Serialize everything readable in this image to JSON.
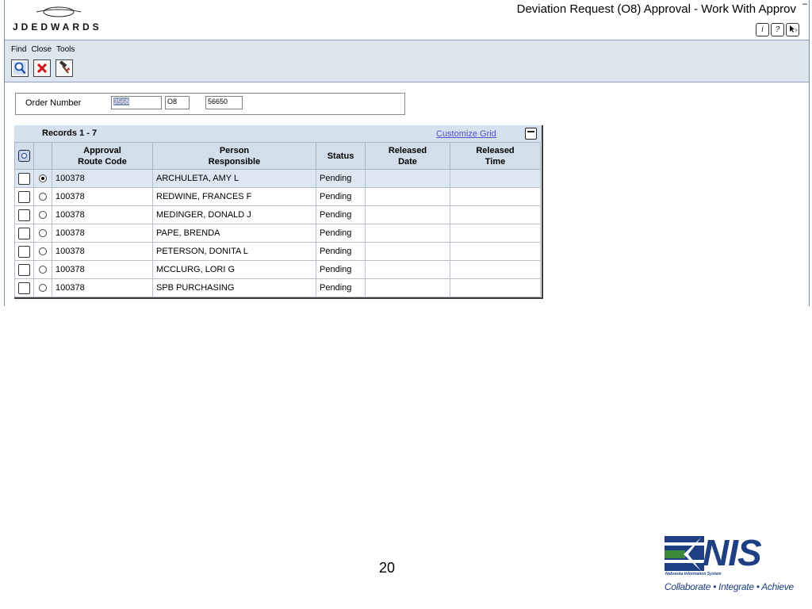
{
  "app": {
    "brand": "JDEDWARDS",
    "title": "Deviation Request (O8) Approval - Work With Approv",
    "help_icons": [
      "i",
      "?",
      "pointer-help"
    ]
  },
  "toolbar": {
    "menus": [
      "Find",
      "Close",
      "Tools"
    ],
    "buttons": [
      {
        "name": "find",
        "icon": "magnifier-icon"
      },
      {
        "name": "close",
        "icon": "red-x-icon"
      },
      {
        "name": "tools",
        "icon": "hammer-icon"
      }
    ]
  },
  "filter": {
    "label": "Order Number",
    "company": "3568",
    "order_type": "O8",
    "order_number": "56650"
  },
  "grid": {
    "records_label": "Records 1 - 7",
    "customize_label": "Customize Grid",
    "columns": [
      {
        "line1": "Approval",
        "line2": "Route Code"
      },
      {
        "line1": "Person",
        "line2": "Responsible"
      },
      {
        "line1": "Status",
        "line2": ""
      },
      {
        "line1": "Released",
        "line2": "Date"
      },
      {
        "line1": "Released",
        "line2": "Time"
      }
    ],
    "rows": [
      {
        "route": "100378",
        "person": "ARCHULETA, AMY L",
        "status": "Pending",
        "date": "",
        "time": "",
        "selected": true
      },
      {
        "route": "100378",
        "person": "REDWINE, FRANCES F",
        "status": "Pending",
        "date": "",
        "time": "",
        "selected": false
      },
      {
        "route": "100378",
        "person": "MEDINGER, DONALD J",
        "status": "Pending",
        "date": "",
        "time": "",
        "selected": false
      },
      {
        "route": "100378",
        "person": "PAPE, BRENDA",
        "status": "Pending",
        "date": "",
        "time": "",
        "selected": false
      },
      {
        "route": "100378",
        "person": "PETERSON, DONITA L",
        "status": "Pending",
        "date": "",
        "time": "",
        "selected": false
      },
      {
        "route": "100378",
        "person": "MCCLURG, LORI G",
        "status": "Pending",
        "date": "",
        "time": "",
        "selected": false
      },
      {
        "route": "100378",
        "person": "SPB PURCHASING",
        "status": "Pending",
        "date": "",
        "time": "",
        "selected": false
      }
    ]
  },
  "slide": {
    "page_number": "20",
    "logo_text": "NIS",
    "logo_subtitle": "Nebraska Information System",
    "tagline": "Collaborate • Integrate • Achieve"
  },
  "colors": {
    "grid_header": "#d2deea",
    "toolbar_bg": "#dde5ee",
    "link": "#5050c8",
    "nis_blue": "#1e3f82",
    "nis_green": "#3a8a3a"
  }
}
